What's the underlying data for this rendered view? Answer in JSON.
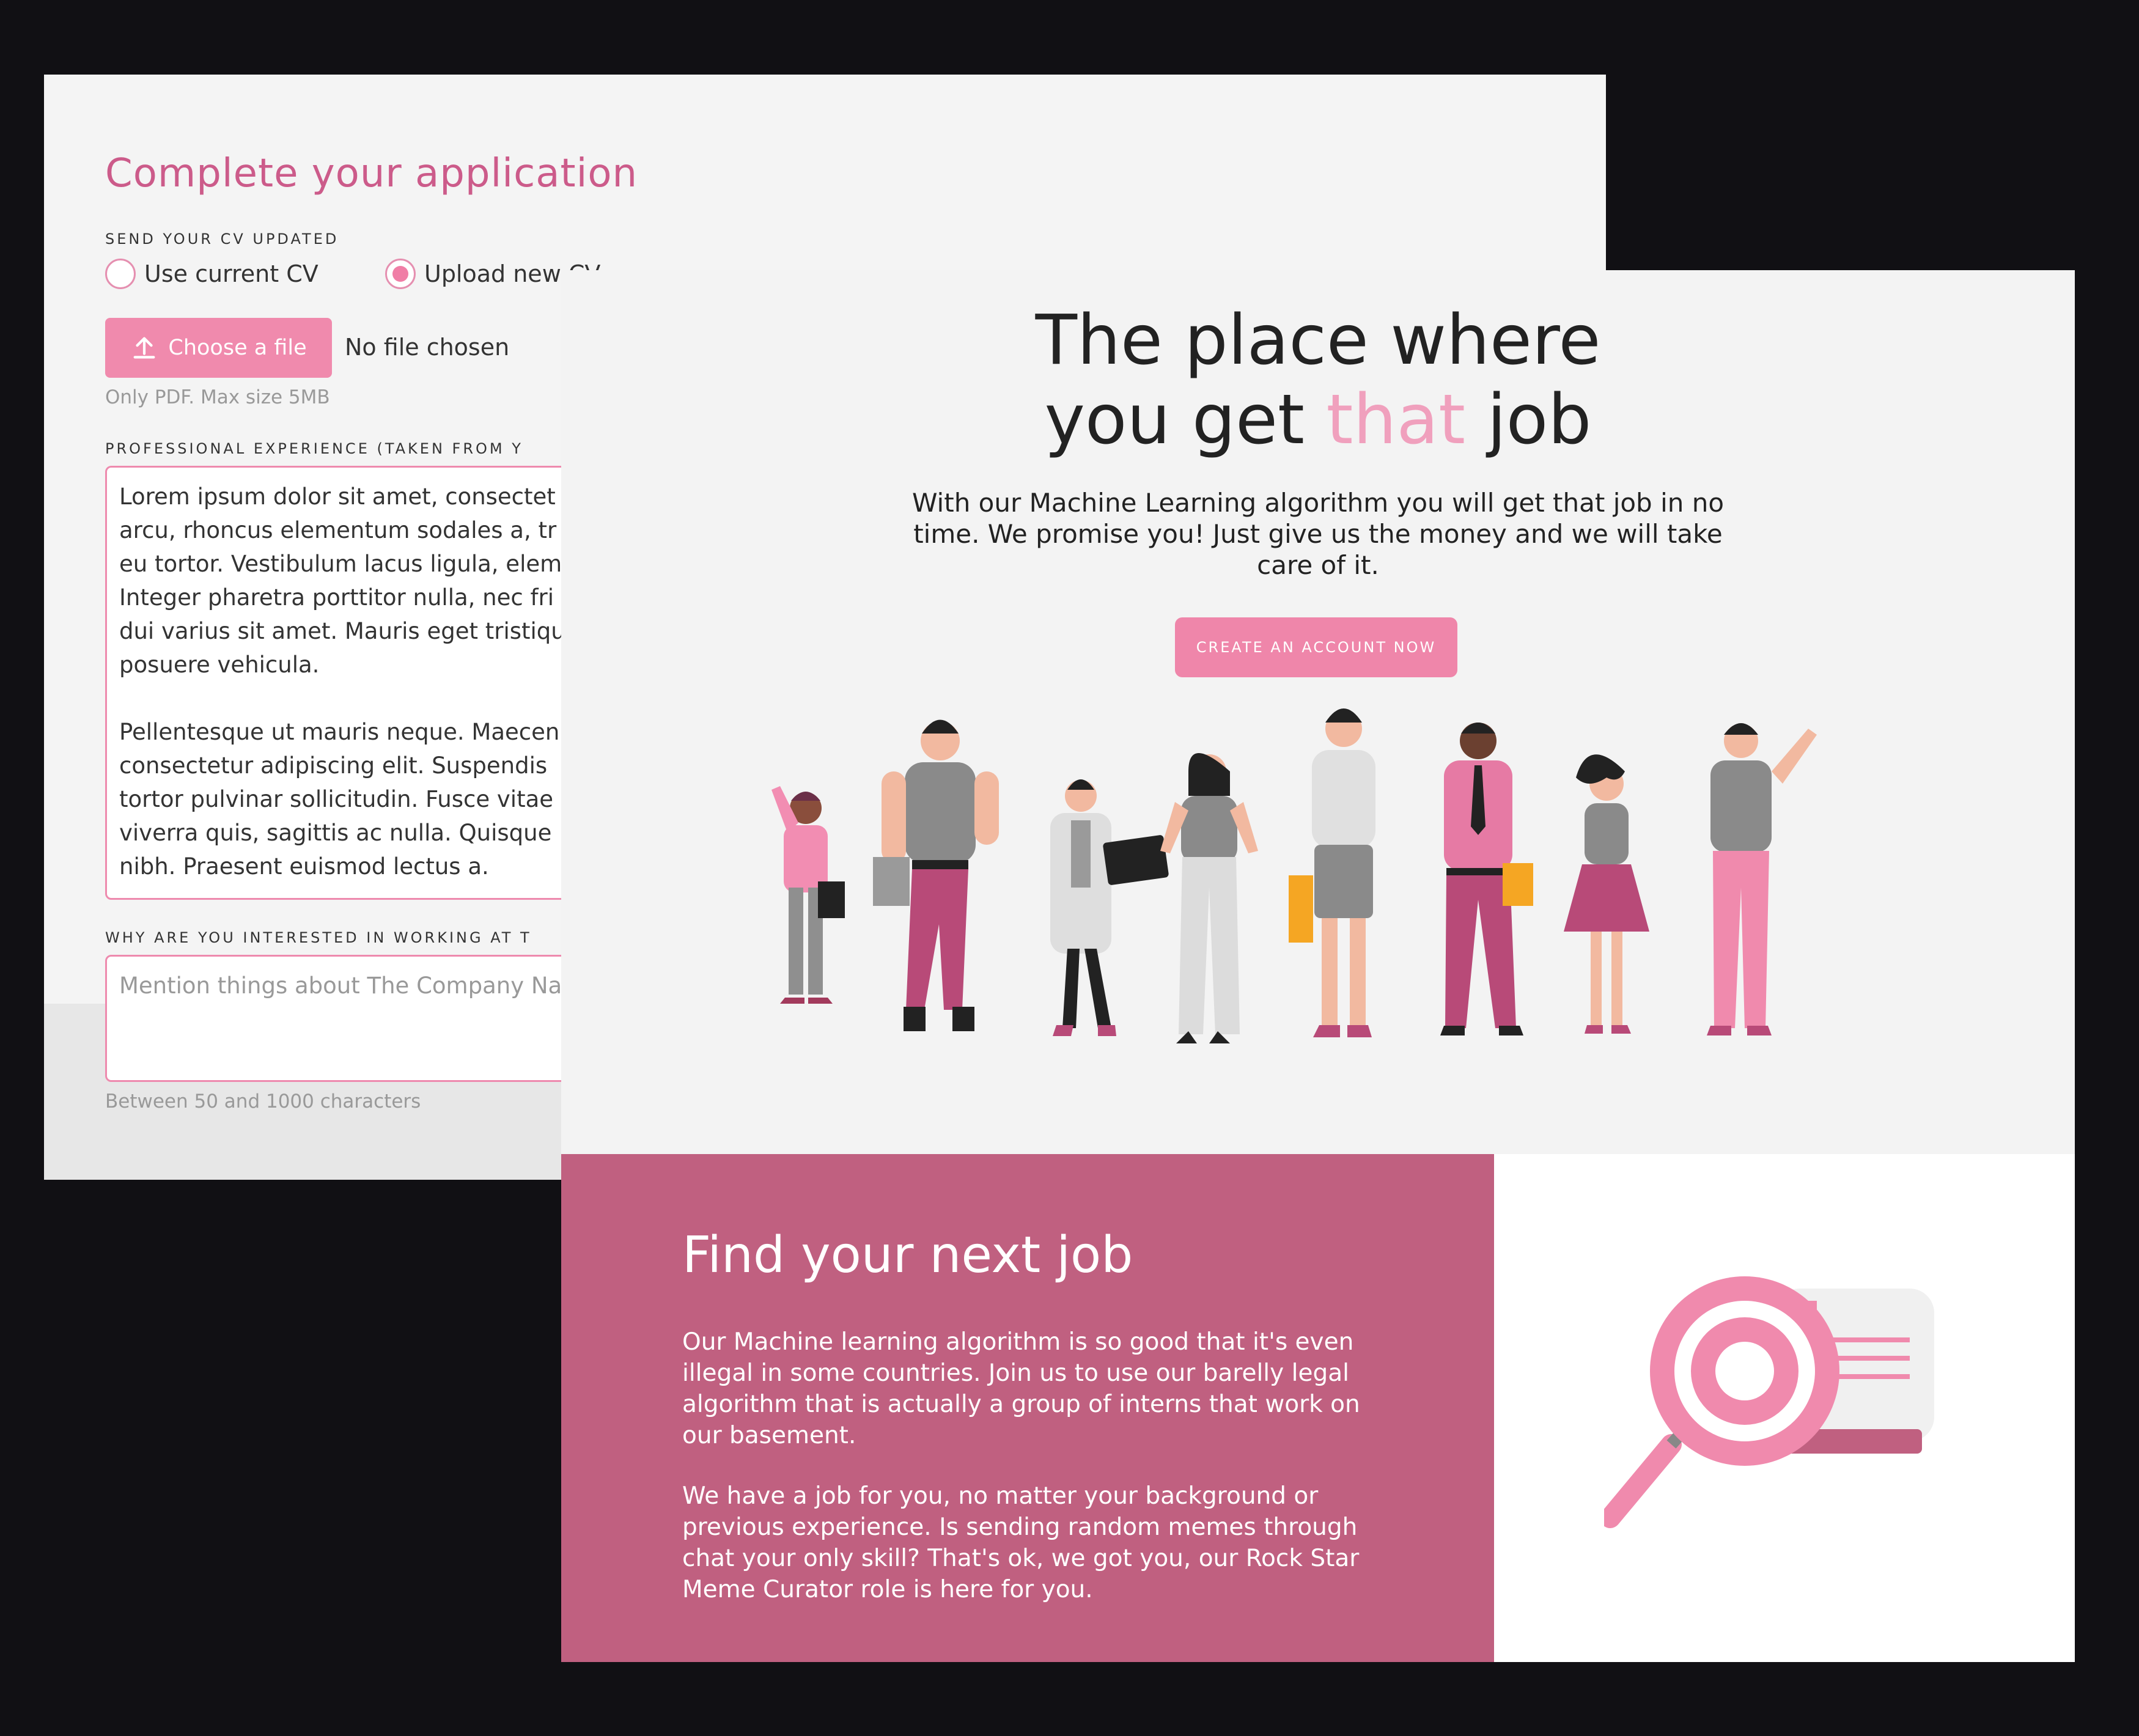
{
  "form": {
    "title": "Complete your application",
    "cv_section_label": "SEND YOUR CV UPDATED",
    "radio_options": [
      "Use current CV",
      "Upload new CV"
    ],
    "selected_option": "Upload new CV",
    "choose_file_label": "Choose a file",
    "no_file_text": "No file chosen",
    "file_hint": "Only PDF. Max size 5MB",
    "experience_label": "PROFESSIONAL EXPERIENCE (TAKEN FROM Y",
    "experience_text": "Lorem ipsum dolor sit amet, consectet\narcu, rhoncus elementum sodales a, tr\neu tortor. Vestibulum lacus ligula, elem\nInteger pharetra porttitor nulla, nec fri\ndui varius sit amet. Mauris eget tristiqu\nposuere vehicula.\n\nPellentesque ut mauris neque. Maecen\nconsectetur adipiscing elit. Suspendis\ntortor pulvinar sollicitudin. Fusce vitae\nviverra quis, sagittis ac nulla. Quisque\nnibh. Praesent euismod lectus a.",
    "interest_label": "WHY ARE YOU INTERESTED IN WORKING AT T",
    "interest_placeholder": "Mention things about The Company Na",
    "char_hint": "Between 50 and 1000 characters"
  },
  "landing": {
    "hero_line1": "The place where",
    "hero_line2_pre": "you get ",
    "hero_line2_accent": "that",
    "hero_line2_post": " job",
    "subtitle": "With our Machine Learning algorithm you will get that job in no time. We promise you! Just give us the money and we will take care of it.",
    "cta_label": "CREATE AN ACCOUNT NOW",
    "find_title": "Find your next job",
    "find_p1": "Our Machine learning algorithm is so good that it's even illegal in some countries. Join us to use our barelly legal algorithm that is actually a group of interns that work on our basement.",
    "find_p2": "We have a job for you, no matter your background or previous experience. Is sending random memes through chat your only skill? That's ok, we got you, our Rock Star Meme Curator role is here for you."
  },
  "icons": {
    "upload": "upload-icon",
    "people": "people-illustration",
    "search": "magnifier-target-illustration"
  },
  "colors": {
    "accent_pink": "#f08aad",
    "title_pink": "#cc5b8a",
    "panel_rose": "#c06080",
    "background": "#111014"
  }
}
